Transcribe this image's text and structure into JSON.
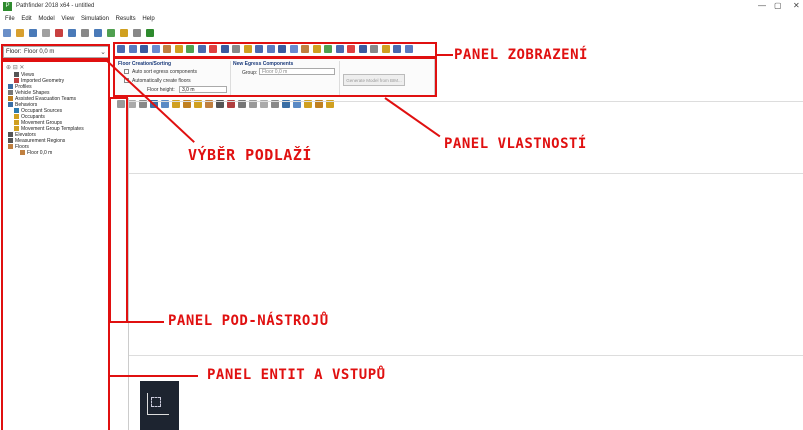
{
  "window": {
    "title": "Pathfinder 2018 x64 - untitled",
    "app_icon_glyph": "P",
    "minimize_glyph": "—",
    "maximize_glyph": "▢",
    "close_glyph": "✕"
  },
  "menu": [
    "File",
    "Edit",
    "Model",
    "View",
    "Simulation",
    "Results",
    "Help"
  ],
  "floor_selector": {
    "label": "Floor:",
    "value": "Floor 0,0 m",
    "chevron": "⌄"
  },
  "left_panel": {
    "header": "⊕ ⊟ ✕",
    "tree": [
      {
        "label": "Views",
        "indent": 1,
        "color": "#555555"
      },
      {
        "label": "Imported Geometry",
        "indent": 1,
        "color": "#c04040"
      },
      {
        "label": "Profiles",
        "indent": 0,
        "color": "#3a6ea5"
      },
      {
        "label": "Vehicle Shapes",
        "indent": 0,
        "color": "#777777"
      },
      {
        "label": "Assisted Evacuation Teams",
        "indent": 0,
        "color": "#c08020"
      },
      {
        "label": "Behaviors",
        "indent": 0,
        "color": "#3a6ea5"
      },
      {
        "label": "Occupant Sources",
        "indent": 1,
        "color": "#2a7ab0"
      },
      {
        "label": "Occupants",
        "indent": 1,
        "color": "#d0a020"
      },
      {
        "label": "Movement Groups",
        "indent": 1,
        "color": "#d0a020"
      },
      {
        "label": "Movement Group Templates",
        "indent": 1,
        "color": "#d0a020"
      },
      {
        "label": "Elevators",
        "indent": 0,
        "color": "#555555"
      },
      {
        "label": "Measurement Regions",
        "indent": 0,
        "color": "#555555"
      },
      {
        "label": "Floors",
        "indent": 0,
        "color": "#c08040"
      },
      {
        "label": "Floor 0,0 m",
        "indent": 2,
        "color": "#c08040"
      }
    ]
  },
  "properties": {
    "floor_creation": {
      "heading": "Floor Creation/Sorting",
      "auto_sort": "Auto sort egress components",
      "auto_create": "Automatically create floors",
      "floor_height_label": "Floor height:",
      "floor_height_value": "3,0 m"
    },
    "egress": {
      "heading": "New Egress Components",
      "group_label": "Group:",
      "group_value": "Floor 0,0 m",
      "button": "Generate Model from BIM..."
    }
  },
  "annotations": {
    "panel_zobrazeni": "PANEL ZOBRAZENÍ",
    "panel_vlastnosti": "PANEL VLASTNOSTÍ",
    "vyber_podlazi": "VÝBĚR PODLAŽÍ",
    "panel_pod_nastroju": "PANEL POD-NÁSTROJŮ",
    "panel_entit": "PANEL ENTIT A VSTUPŮ"
  },
  "colors": {
    "annotation_red": "#e01010"
  }
}
